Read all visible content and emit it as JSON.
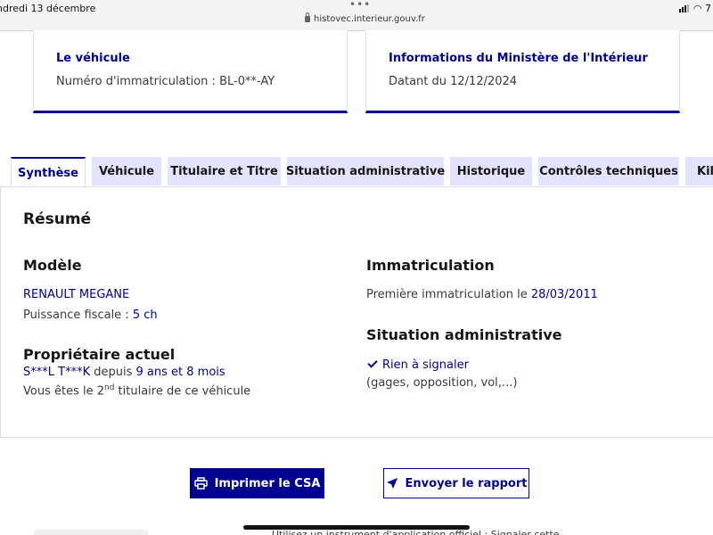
{
  "status_bar": {
    "date": "ndredi 13 décembre",
    "url": "histovec.interieur.gouv.fr",
    "battery": "7",
    "menu_dots": "•••"
  },
  "cards": [
    {
      "title": "Le véhicule",
      "text": "Numéro d'immatriculation : BL-0**-AY"
    },
    {
      "title": "Informations du Ministère de l'Intérieur",
      "text": "Datant du 12/12/2024"
    }
  ],
  "tabs": [
    {
      "label": "Synthèse",
      "active": true
    },
    {
      "label": "Véhicule"
    },
    {
      "label": "Titulaire et Titre"
    },
    {
      "label": "Situation administrative"
    },
    {
      "label": "Historique"
    },
    {
      "label": "Contrôles techniques"
    },
    {
      "label": "Kil"
    }
  ],
  "summary": {
    "heading": "Résumé",
    "modele": {
      "title": "Modèle",
      "name": "RENAULT MEGANE",
      "puissance_label": "Puissance fiscale :",
      "puissance_value": "5 ch"
    },
    "proprietaire": {
      "title": "Propriétaire actuel",
      "name": "S***L T***K",
      "depuis_label": "depuis",
      "depuis_value": "9 ans et 8 mois",
      "rank_prefix": "Vous êtes le 2",
      "rank_sup": "nd",
      "rank_suffix": " titulaire de ce véhicule"
    },
    "immatriculation": {
      "title": "Immatriculation",
      "label": "Première immatriculation le",
      "date": "28/03/2011"
    },
    "situation": {
      "title": "Situation administrative",
      "status": "Rien à signaler",
      "details": "(gages, opposition, vol,...)"
    }
  },
  "actions": {
    "print_label": "Imprimer le CSA",
    "send_label": "Envoyer le rapport"
  },
  "footer": {
    "partial_text": "Utilisez un instrument d'application officiel : Signaler cette"
  },
  "colors": {
    "accent": "#000091",
    "tab_bg": "#e3e3fd",
    "text": "#161616",
    "muted": "#3a3a3a"
  }
}
